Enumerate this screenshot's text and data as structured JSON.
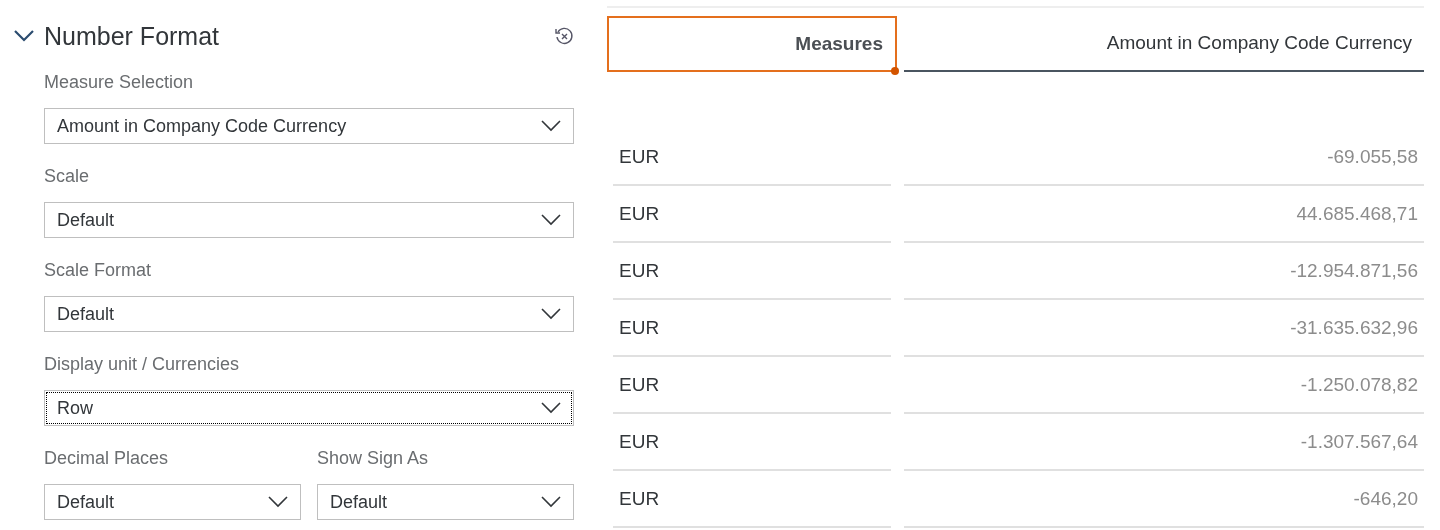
{
  "panel": {
    "title": "Number Format",
    "expanded": true,
    "fields": [
      {
        "label": "Measure Selection",
        "value": "Amount in Company Code Currency",
        "focused": false
      },
      {
        "label": "Scale",
        "value": "Default",
        "focused": false
      },
      {
        "label": "Scale Format",
        "value": "Default",
        "focused": false
      },
      {
        "label": "Display unit / Currencies",
        "value": "Row",
        "focused": true
      }
    ],
    "pair": [
      {
        "label": "Decimal Places",
        "value": "Default",
        "focused": false
      },
      {
        "label": "Show Sign As",
        "value": "Default",
        "focused": false
      }
    ]
  },
  "table": {
    "headers": [
      {
        "label": "Measures",
        "selected": true
      },
      {
        "label": "Amount in Company Code Currency",
        "selected": false
      }
    ],
    "rows": [
      {
        "unit": "EUR",
        "amount": "-69.055,58"
      },
      {
        "unit": "EUR",
        "amount": "44.685.468,71"
      },
      {
        "unit": "EUR",
        "amount": "-12.954.871,56"
      },
      {
        "unit": "EUR",
        "amount": "-31.635.632,96"
      },
      {
        "unit": "EUR",
        "amount": "-1.250.078,82"
      },
      {
        "unit": "EUR",
        "amount": "-1.307.567,64"
      },
      {
        "unit": "EUR",
        "amount": "-646,20"
      }
    ]
  }
}
